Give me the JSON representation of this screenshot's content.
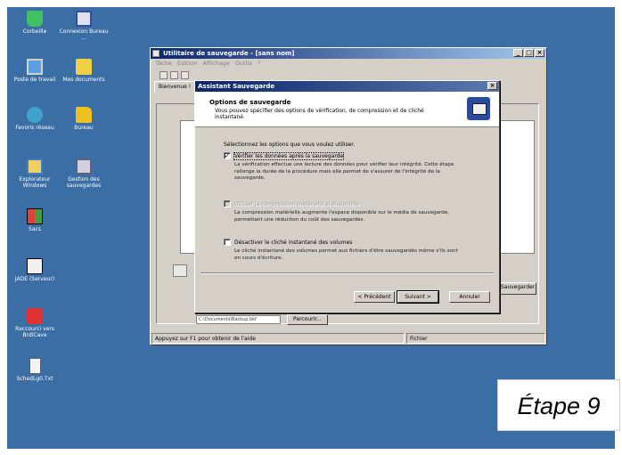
{
  "desktop_icons": [
    {
      "name": "recycle-bin-icon",
      "label": "Corbeille",
      "color": "#40c060"
    },
    {
      "name": "network-connections-icon",
      "label": "Connexion Bureau ...",
      "color": "#e0e0f0"
    },
    {
      "name": "my-computer-icon",
      "label": "Poste de travail",
      "color": "#5aa0e0"
    },
    {
      "name": "my-documents-icon",
      "label": "Mes documents",
      "color": "#f0d040"
    },
    {
      "name": "network-icon",
      "label": "Favoris réseau",
      "color": "#40a0d0"
    },
    {
      "name": "desktop-folder-icon",
      "label": "Bureau",
      "color": "#f0c020"
    },
    {
      "name": "explorer-icon",
      "label": "Explorateur Windows",
      "color": "#f0d060"
    },
    {
      "name": "backup-manager-icon",
      "label": "Gestion des sauvegardes",
      "color": "#d0d0e0"
    },
    {
      "name": "sacs-icon",
      "label": "Sacs",
      "color": "#e04040"
    },
    {
      "name": "jade-server-icon",
      "label": "JADE (Serveur)",
      "color": "#f0f0f0"
    },
    {
      "name": "shortcut-icon",
      "label": "Raccourci vers BrdiCave",
      "color": "#e03030"
    },
    {
      "name": "text-file-icon",
      "label": "SchedLg0.Txt",
      "color": "#f4f4f4"
    }
  ],
  "main_window": {
    "title": "Utilitaire de sauvegarde - [sans nom]",
    "menu": [
      "Tâche",
      "Édition",
      "Affichage",
      "Outils",
      "?"
    ],
    "tab_label": "Bienvenue !",
    "bg_field_value": "C:\\Documents\\Backup.bkf",
    "browse_label": "Parcourir...",
    "save_label": "Sauvegarder",
    "status_help": "Appuyez sur F1 pour obtenir de l'aide",
    "status_right": "Fichier"
  },
  "dialog": {
    "title": "Assistant Sauvegarde",
    "header_title": "Options de sauvegarde",
    "header_subtitle": "Vous pouvez spécifier des options de vérification, de compression et de cliché instantané.",
    "select_prompt": "Sélectionnez les options que vous voulez utiliser.",
    "options": [
      {
        "label": "Vérifier les données après la sauvegarde",
        "checked": true,
        "enabled": true,
        "description": "La vérification effectue une lecture des données pour vérifier leur intégrité. Cette étape rallonge la durée de la procédure mais elle permet de s'assurer de l'intégrité de la sauvegarde."
      },
      {
        "label": "Utiliser la compression matérielle si disponible",
        "checked": false,
        "enabled": false,
        "description": "La compression matérielle augmente l'espace disponible sur le média de sauvegarde, permettant une réduction du coût des sauvegardes."
      },
      {
        "label": "Désactiver le cliché instantané des volumes",
        "checked": false,
        "enabled": true,
        "description": "Le cliché instantané des volumes permet aux fichiers d'être sauvegardés même s'ils sont en cours d'écriture."
      }
    ],
    "buttons": {
      "back": "< Précédent",
      "next": "Suivant >",
      "cancel": "Annuler"
    }
  },
  "step_label": "Étape 9",
  "colors": {
    "desktop": "#3a6ea5",
    "title_active": "#0a246a",
    "face": "#d4d0c8"
  }
}
